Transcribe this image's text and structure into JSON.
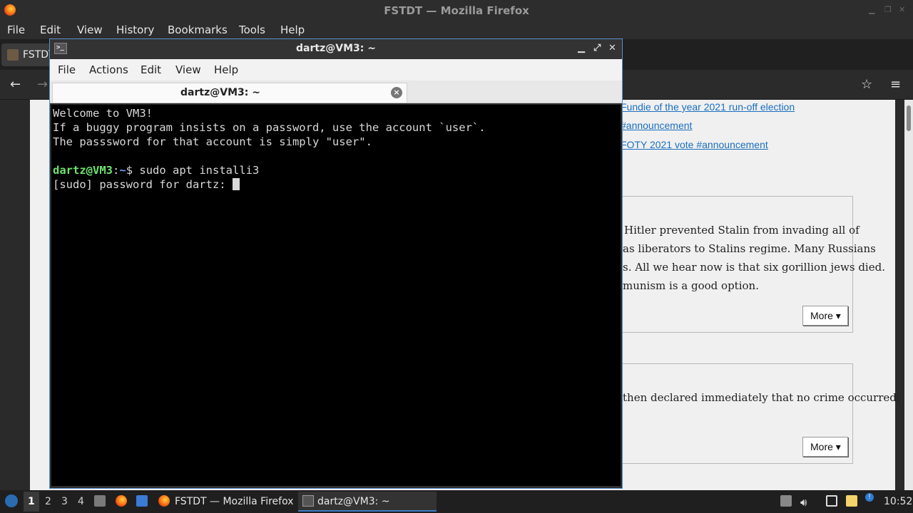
{
  "firefox": {
    "title": "FSTDT — Mozilla Firefox",
    "menu": [
      "File",
      "Edit",
      "View",
      "History",
      "Bookmarks",
      "Tools",
      "Help"
    ],
    "tab_title": "FSTDT",
    "links": [
      "Fundie of the year 2021 run-off election",
      "#announcement",
      "FOTY 2021 vote #announcement"
    ],
    "card1_lines": [
      "Hitler prevented Stalin from invading all of",
      "as liberators to Stalins regime. Many Russians",
      "s. All we hear now is that six gorillion jews died.",
      "munism is a good option."
    ],
    "card2_lines": [
      "then declared immediately that no crime occurred,"
    ],
    "more_label": "More ▾"
  },
  "terminal": {
    "window_title": "dartz@VM3: ~",
    "menu": [
      "File",
      "Actions",
      "Edit",
      "View",
      "Help"
    ],
    "tab_title": "dartz@VM3: ~",
    "lines": [
      "Welcome to VM3!",
      "If a buggy program insists on a password, use the account `user`.",
      "The passsword for that account is simply \"user\"."
    ],
    "prompt_user": "dartz@VM3",
    "prompt_sep": ":",
    "prompt_path": "~",
    "prompt_symbol": "$ ",
    "command": "sudo apt installi3",
    "sudo_prompt": "[sudo] password for dartz: "
  },
  "taskbar": {
    "workspaces": [
      "1",
      "2",
      "3",
      "4"
    ],
    "active_workspace": "1",
    "tasks": [
      "FSTDT — Mozilla Firefox",
      "dartz@VM3: ~"
    ],
    "clock": "10:52",
    "accent": "#3b7bc8"
  }
}
